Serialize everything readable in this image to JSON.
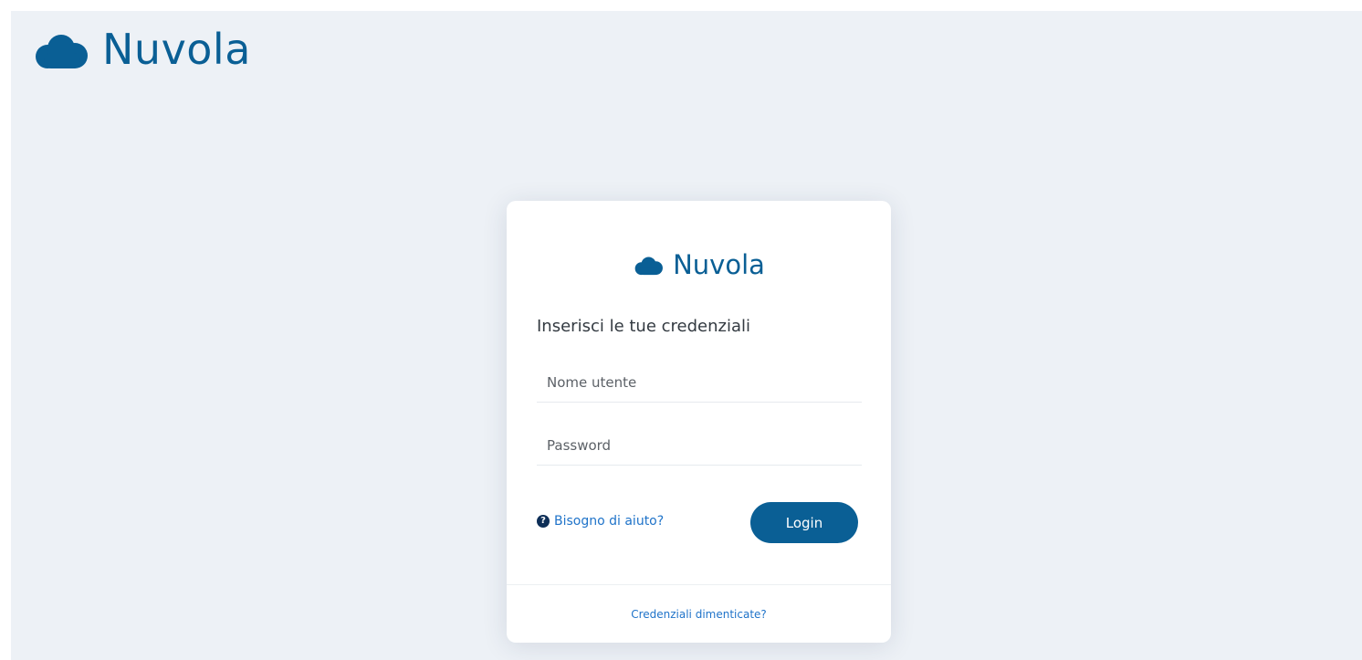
{
  "header": {
    "brand_name": "Nuvola",
    "logo_icon": "cloud-icon",
    "brand_color": "#0a5f95"
  },
  "login_card": {
    "brand_name": "Nuvola",
    "logo_icon": "cloud-icon",
    "title": "Inserisci le tue credenziali",
    "username": {
      "placeholder": "Nome utente",
      "value": ""
    },
    "password": {
      "placeholder": "Password",
      "value": ""
    },
    "help_link": {
      "label": "Bisogno di aiuto?",
      "icon": "question-circle-icon"
    },
    "login_button": {
      "label": "Login"
    },
    "forgot_link": {
      "label": "Credenziali dimenticate?"
    }
  },
  "colors": {
    "background": "#edf1f6",
    "accent": "#0a5f95",
    "link": "#1f73c9"
  }
}
